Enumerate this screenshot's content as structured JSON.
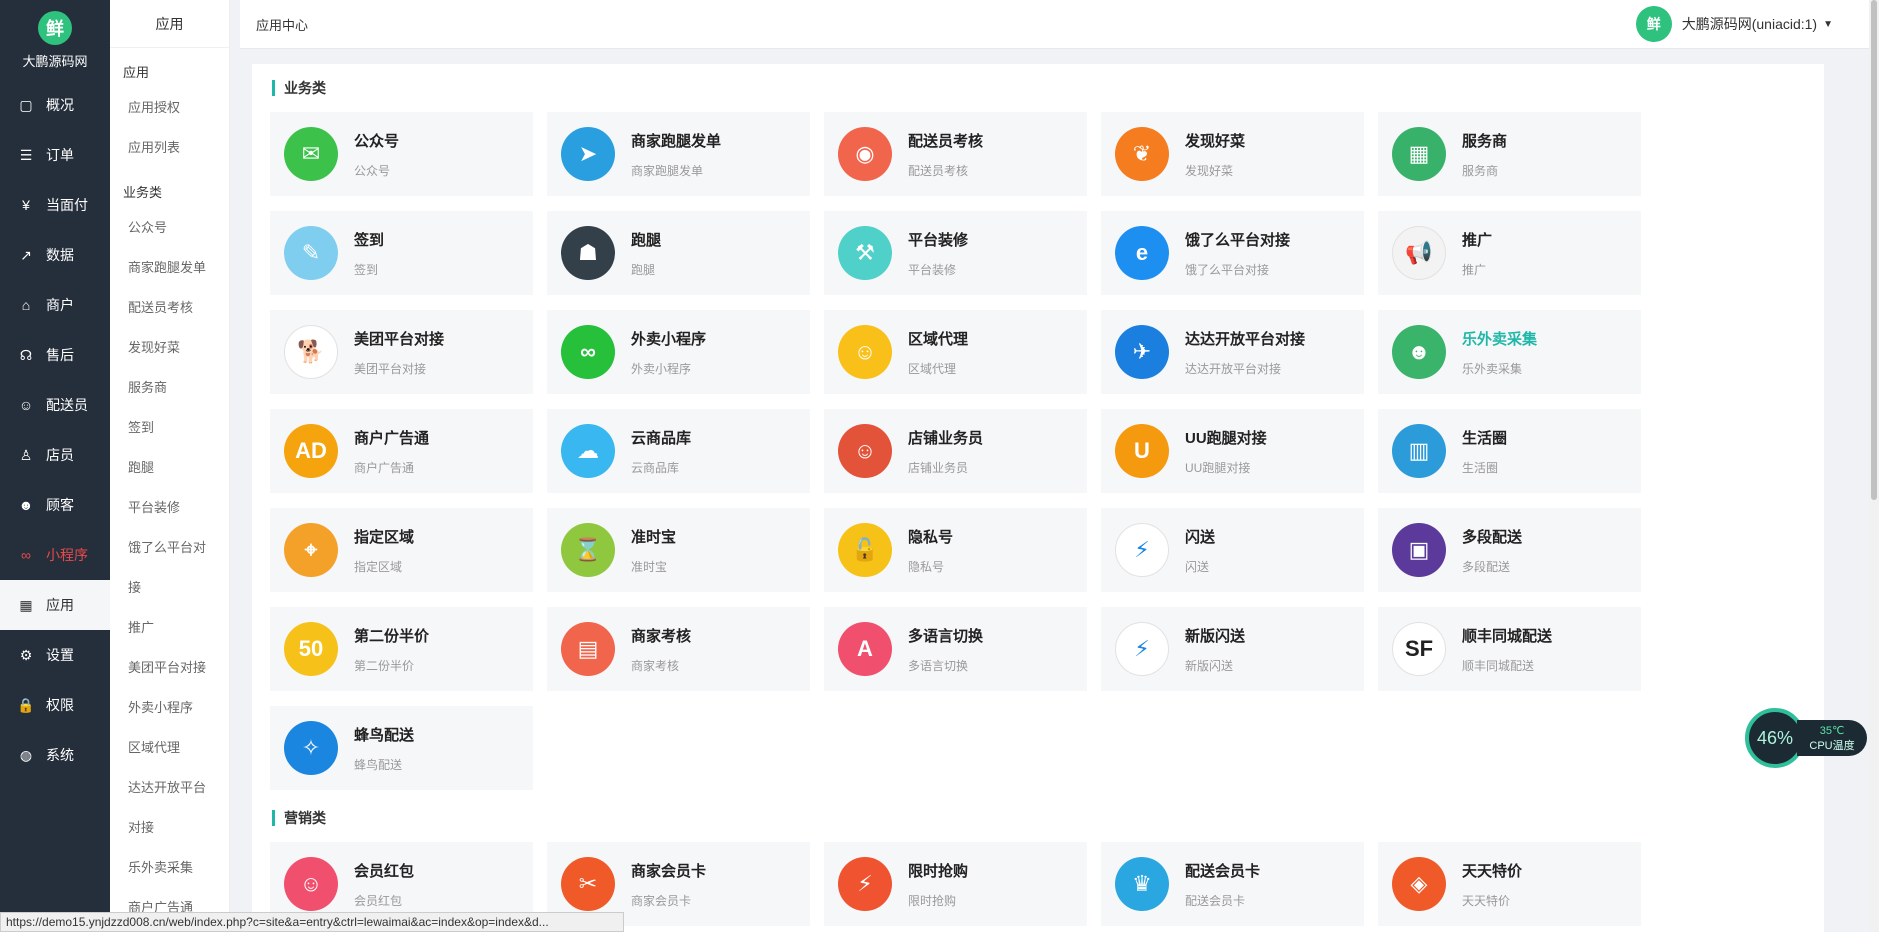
{
  "brand": {
    "name": "大鹏源码网",
    "logo_char": "鲜"
  },
  "nav": [
    {
      "label": "概况",
      "icon": "dashboard-icon"
    },
    {
      "label": "订单",
      "icon": "order-icon"
    },
    {
      "label": "当面付",
      "icon": "yuan-icon"
    },
    {
      "label": "数据",
      "icon": "chart-icon"
    },
    {
      "label": "商户",
      "icon": "store-icon"
    },
    {
      "label": "售后",
      "icon": "service-icon"
    },
    {
      "label": "配送员",
      "icon": "person-icon"
    },
    {
      "label": "店员",
      "icon": "clerk-icon"
    },
    {
      "label": "顾客",
      "icon": "customer-icon"
    },
    {
      "label": "小程序",
      "icon": "miniprogram-icon"
    },
    {
      "label": "应用",
      "icon": "apps-icon"
    },
    {
      "label": "设置",
      "icon": "gear-icon"
    },
    {
      "label": "权限",
      "icon": "lock-icon"
    },
    {
      "label": "系统",
      "icon": "system-icon"
    }
  ],
  "submenu": {
    "title": "应用",
    "items": [
      {
        "kind": "group",
        "label": "应用"
      },
      {
        "kind": "sub",
        "label": "应用授权"
      },
      {
        "kind": "sub",
        "label": "应用列表"
      },
      {
        "kind": "group",
        "label": "业务类"
      },
      {
        "kind": "sub",
        "label": "公众号"
      },
      {
        "kind": "sub",
        "label": "商家跑腿发单"
      },
      {
        "kind": "sub",
        "label": "配送员考核"
      },
      {
        "kind": "sub",
        "label": "发现好菜"
      },
      {
        "kind": "sub",
        "label": "服务商"
      },
      {
        "kind": "sub",
        "label": "签到"
      },
      {
        "kind": "sub",
        "label": "跑腿"
      },
      {
        "kind": "sub",
        "label": "平台装修"
      },
      {
        "kind": "sub",
        "label": "饿了么平台对接"
      },
      {
        "kind": "sub",
        "label": "推广"
      },
      {
        "kind": "sub",
        "label": "美团平台对接"
      },
      {
        "kind": "sub",
        "label": "外卖小程序"
      },
      {
        "kind": "sub",
        "label": "区域代理"
      },
      {
        "kind": "sub",
        "label": "达达开放平台对接"
      },
      {
        "kind": "sub",
        "label": "乐外卖采集"
      },
      {
        "kind": "sub",
        "label": "商户广告通"
      }
    ]
  },
  "topbar": {
    "breadcrumb": "应用中心",
    "user": "大鹏源码网(uniacid:1)"
  },
  "sections": [
    {
      "title": "业务类",
      "apps": [
        {
          "name": "公众号",
          "desc": "公众号",
          "color": "#3cc14a",
          "glyph": "✉"
        },
        {
          "name": "商家跑腿发单",
          "desc": "商家跑腿发单",
          "color": "#2a9fe0",
          "glyph": "➤"
        },
        {
          "name": "配送员考核",
          "desc": "配送员考核",
          "color": "#f0654c",
          "glyph": "◉"
        },
        {
          "name": "发现好菜",
          "desc": "发现好菜",
          "color": "#f57c1f",
          "glyph": "❦"
        },
        {
          "name": "服务商",
          "desc": "服务商",
          "color": "#38b26a",
          "glyph": "▦"
        },
        {
          "name": "签到",
          "desc": "签到",
          "color": "#7fcdef",
          "glyph": "✎"
        },
        {
          "name": "跑腿",
          "desc": "跑腿",
          "color": "#33404a",
          "glyph": "☗"
        },
        {
          "name": "平台装修",
          "desc": "平台装修",
          "color": "#4fd0c8",
          "glyph": "⚒"
        },
        {
          "name": "饿了么平台对接",
          "desc": "饿了么平台对接",
          "color": "#1d8ff0",
          "glyph": "e"
        },
        {
          "name": "推广",
          "desc": "推广",
          "color": "#f3f3f3",
          "glyph": "📢"
        },
        {
          "name": "美团平台对接",
          "desc": "美团平台对接",
          "color": "#ffffff",
          "glyph": "🐕"
        },
        {
          "name": "外卖小程序",
          "desc": "外卖小程序",
          "color": "#26c03b",
          "glyph": "∞"
        },
        {
          "name": "区域代理",
          "desc": "区域代理",
          "color": "#f9c01a",
          "glyph": "☺"
        },
        {
          "name": "达达开放平台对接",
          "desc": "达达开放平台对接",
          "color": "#1b7fe0",
          "glyph": "✈"
        },
        {
          "name": "乐外卖采集",
          "desc": "乐外卖采集",
          "color": "#39b46a",
          "glyph": "☻",
          "highlight": true
        },
        {
          "name": "商户广告通",
          "desc": "商户广告通",
          "color": "#f5a40e",
          "glyph": "AD"
        },
        {
          "name": "云商品库",
          "desc": "云商品库",
          "color": "#39b7f0",
          "glyph": "☁"
        },
        {
          "name": "店铺业务员",
          "desc": "店铺业务员",
          "color": "#e2533a",
          "glyph": "☺"
        },
        {
          "name": "UU跑腿对接",
          "desc": "UU跑腿对接",
          "color": "#f59a0e",
          "glyph": "U"
        },
        {
          "name": "生活圈",
          "desc": "生活圈",
          "color": "#2b9bd9",
          "glyph": "▥"
        },
        {
          "name": "指定区域",
          "desc": "指定区域",
          "color": "#f4a12a",
          "glyph": "⌖"
        },
        {
          "name": "准时宝",
          "desc": "准时宝",
          "color": "#8fc73e",
          "glyph": "⌛"
        },
        {
          "name": "隐私号",
          "desc": "隐私号",
          "color": "#f7c218",
          "glyph": "🔓"
        },
        {
          "name": "闪送",
          "desc": "闪送",
          "color": "#ffffff",
          "glyph": "⚡"
        },
        {
          "name": "多段配送",
          "desc": "多段配送",
          "color": "#5b3a9b",
          "glyph": "▣"
        },
        {
          "name": "第二份半价",
          "desc": "第二份半价",
          "color": "#f6c21a",
          "glyph": "50"
        },
        {
          "name": "商家考核",
          "desc": "商家考核",
          "color": "#f0654c",
          "glyph": "▤"
        },
        {
          "name": "多语言切换",
          "desc": "多语言切换",
          "color": "#f0506e",
          "glyph": "A"
        },
        {
          "name": "新版闪送",
          "desc": "新版闪送",
          "color": "#ffffff",
          "glyph": "⚡"
        },
        {
          "name": "顺丰同城配送",
          "desc": "顺丰同城配送",
          "color": "#ffffff",
          "glyph": "SF"
        },
        {
          "name": "蜂鸟配送",
          "desc": "蜂鸟配送",
          "color": "#1b86e0",
          "glyph": "✧"
        }
      ]
    },
    {
      "title": "营销类",
      "apps": [
        {
          "name": "会员红包",
          "desc": "会员红包",
          "color": "#f0506e",
          "glyph": "☺"
        },
        {
          "name": "商家会员卡",
          "desc": "商家会员卡",
          "color": "#f05a28",
          "glyph": "✂"
        },
        {
          "name": "限时抢购",
          "desc": "限时抢购",
          "color": "#f0532f",
          "glyph": "⚡"
        },
        {
          "name": "配送会员卡",
          "desc": "配送会员卡",
          "color": "#2aa7e0",
          "glyph": "♛"
        },
        {
          "name": "天天特价",
          "desc": "天天特价",
          "color": "#f05a28",
          "glyph": "◈"
        }
      ]
    }
  ],
  "cpu": {
    "percent": "46%",
    "temp": "35℃",
    "label": "CPU温度"
  },
  "status_url": "https://demo15.ynjdzzd008.cn/web/index.php?c=site&a=entry&ctrl=lewaimai&ac=index&op=index&d..."
}
